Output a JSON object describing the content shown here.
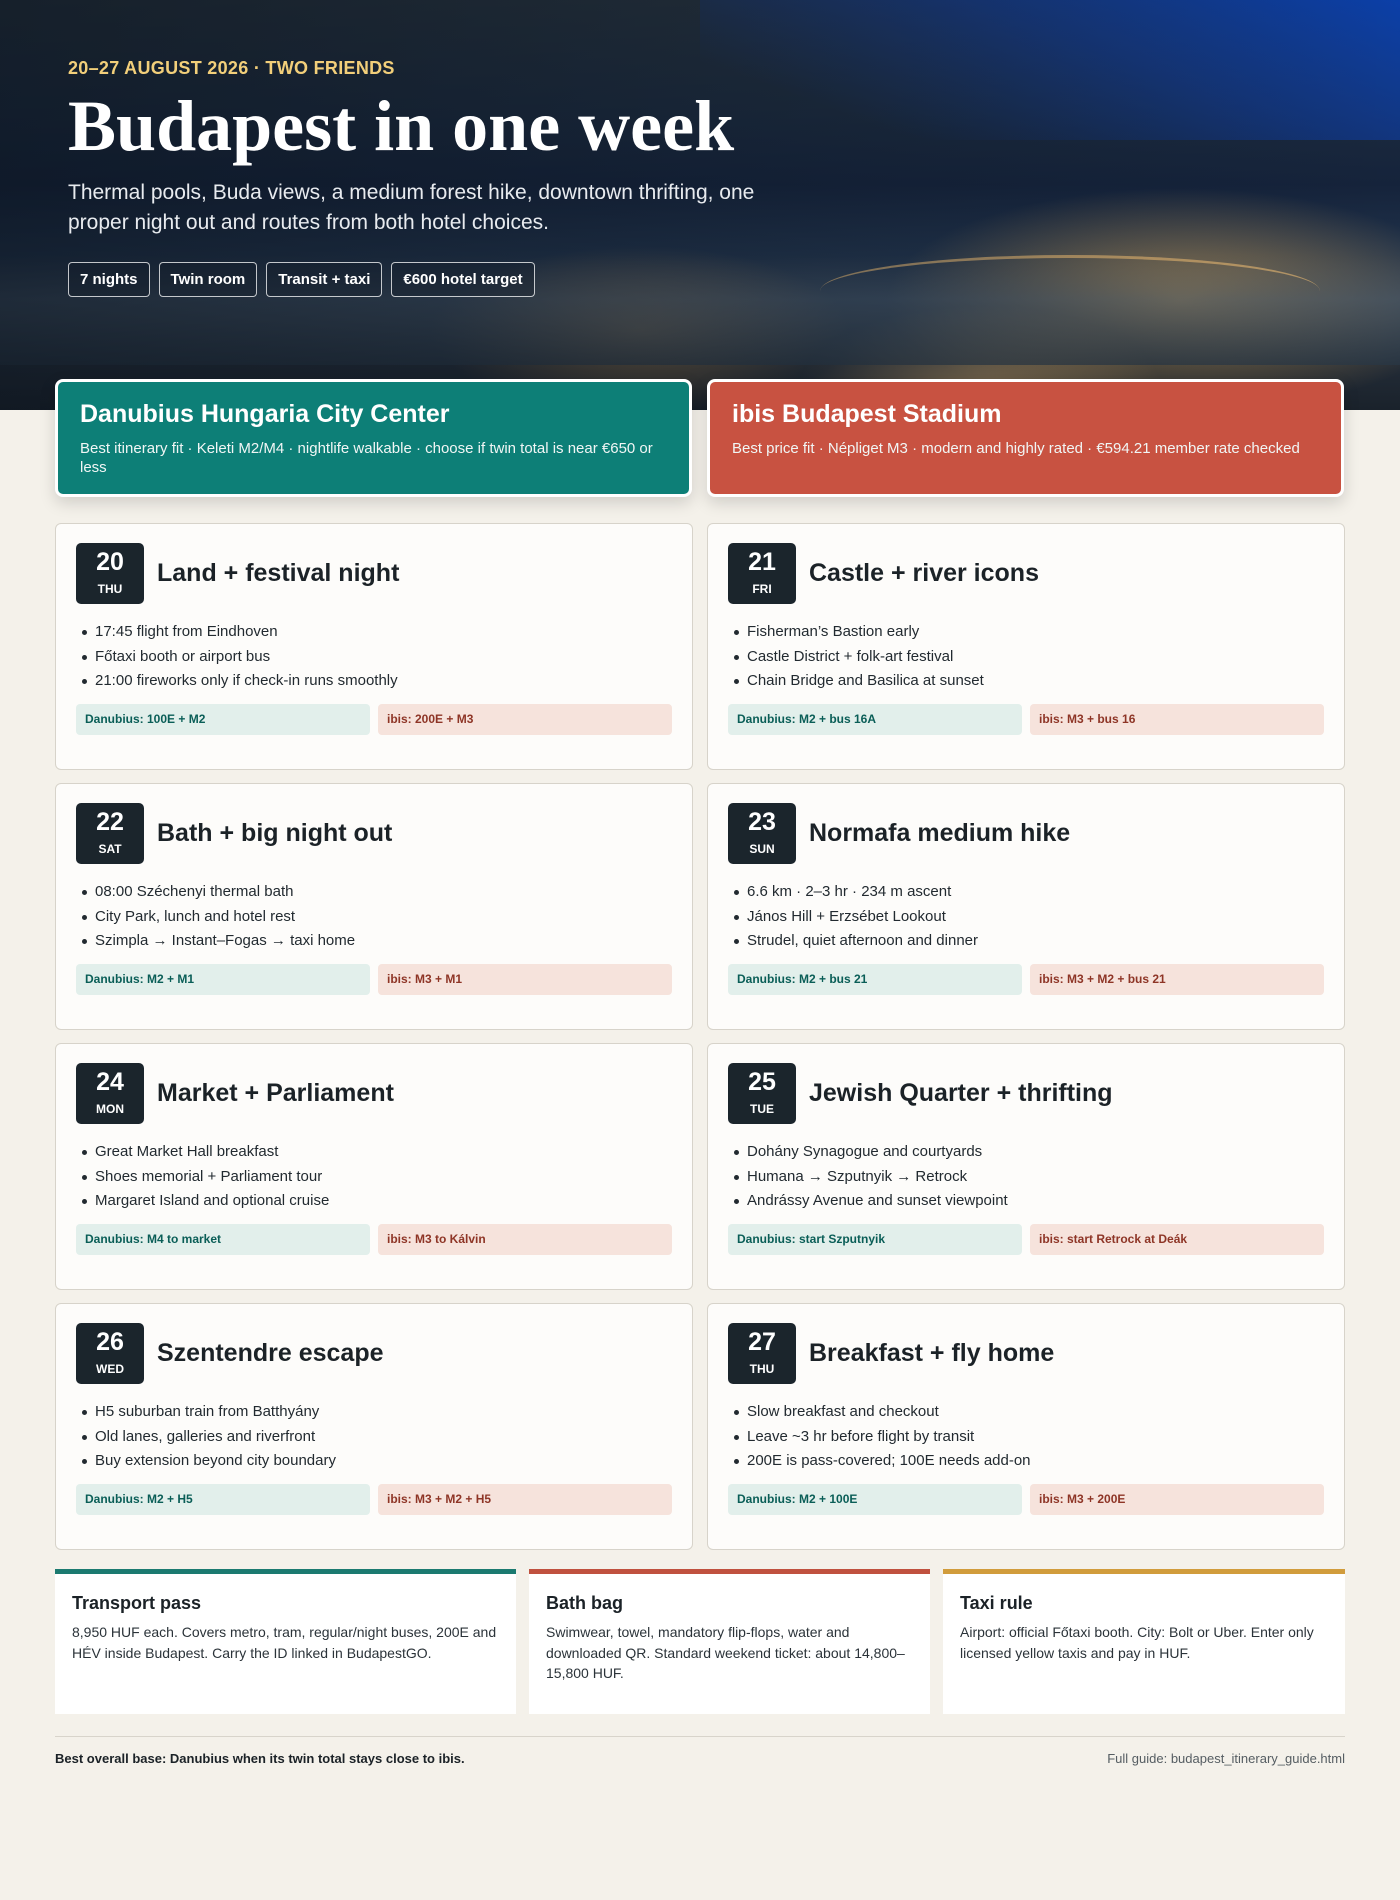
{
  "hero": {
    "eyebrow": "20–27 AUGUST 2026 · TWO FRIENDS",
    "title": "Budapest in one week",
    "subtitle": "Thermal pools, Buda views, a medium forest hike, downtown thrifting, one proper night out and routes from both hotel choices.",
    "chips": [
      "7 nights",
      "Twin room",
      "Transit + taxi",
      "€600 hotel target"
    ]
  },
  "hotels": {
    "danubius": {
      "name": "Danubius Hungaria City Center",
      "desc": "Best itinerary fit · Keleti M2/M4 · nightlife walkable · choose if twin total is near €650 or less",
      "color": "#0d7f77"
    },
    "ibis": {
      "name": "ibis Budapest Stadium",
      "desc": "Best price fit · Népliget M3 · modern and highly rated · €594.21 member rate checked",
      "color": "#c85241"
    }
  },
  "days": [
    {
      "num": "20",
      "dow": "THU",
      "title": "Land + festival night",
      "bullets": [
        "17:45 flight from Eindhoven",
        "Főtaxi booth or airport bus",
        "21:00 fireworks only if check-in runs smoothly"
      ],
      "danubius": "Danubius: 100E + M2",
      "ibis": "ibis: 200E + M3"
    },
    {
      "num": "21",
      "dow": "FRI",
      "title": "Castle + river icons",
      "bullets": [
        "Fisherman’s Bastion early",
        "Castle District + folk-art festival",
        "Chain Bridge and Basilica at sunset"
      ],
      "danubius": "Danubius: M2 + bus 16A",
      "ibis": "ibis: M3 + bus 16"
    },
    {
      "num": "22",
      "dow": "SAT",
      "title": "Bath + big night out",
      "bullets": [
        "08:00 Széchenyi thermal bath",
        "City Park, lunch and hotel rest",
        "Szimpla → Instant–Fogas → taxi home"
      ],
      "danubius": "Danubius: M2 + M1",
      "ibis": "ibis: M3 + M1"
    },
    {
      "num": "23",
      "dow": "SUN",
      "title": "Normafa medium hike",
      "bullets": [
        "6.6 km · 2–3 hr · 234 m ascent",
        "János Hill + Erzsébet Lookout",
        "Strudel, quiet afternoon and dinner"
      ],
      "danubius": "Danubius: M2 + bus 21",
      "ibis": "ibis: M3 + M2 + bus 21"
    },
    {
      "num": "24",
      "dow": "MON",
      "title": "Market + Parliament",
      "bullets": [
        "Great Market Hall breakfast",
        "Shoes memorial + Parliament tour",
        "Margaret Island and optional cruise"
      ],
      "danubius": "Danubius: M4 to market",
      "ibis": "ibis: M3 to Kálvin"
    },
    {
      "num": "25",
      "dow": "TUE",
      "title": "Jewish Quarter + thrifting",
      "bullets": [
        "Dohány Synagogue and courtyards",
        "Humana → Szputnyik → Retrock",
        "Andrássy Avenue and sunset viewpoint"
      ],
      "danubius": "Danubius: start Szputnyik",
      "ibis": "ibis: start Retrock at Deák"
    },
    {
      "num": "26",
      "dow": "WED",
      "title": "Szentendre escape",
      "bullets": [
        "H5 suburban train from Batthyány",
        "Old lanes, galleries and riverfront",
        "Buy extension beyond city boundary"
      ],
      "danubius": "Danubius: M2 + H5",
      "ibis": "ibis: M3 + M2 + H5"
    },
    {
      "num": "27",
      "dow": "THU",
      "title": "Breakfast + fly home",
      "bullets": [
        "Slow breakfast and checkout",
        "Leave ~3 hr before flight by transit",
        "200E is pass-covered; 100E needs add-on"
      ],
      "danubius": "Danubius: M2 + 100E",
      "ibis": "ibis: M3 + 200E"
    }
  ],
  "info": [
    {
      "title": "Transport pass",
      "body": "8,950 HUF each. Covers metro, tram, regular/night buses, 200E and HÉV inside Budapest. Carry the ID linked in BudapestGO.",
      "color": "#1b7a70"
    },
    {
      "title": "Bath bag",
      "body": "Swimwear, towel, mandatory flip-flops, water and downloaded QR. Standard weekend ticket: about 14,800–15,800 HUF.",
      "color": "#c0513f"
    },
    {
      "title": "Taxi rule",
      "body": "Airport: official Főtaxi booth. City: Bolt or Uber. Enter only licensed yellow taxis and pay in HUF.",
      "color": "#d19c3c"
    }
  ],
  "footer": {
    "left": "Best overall base: Danubius when its twin total stays close to ibis.",
    "right": "Full guide: budapest_itinerary_guide.html"
  }
}
